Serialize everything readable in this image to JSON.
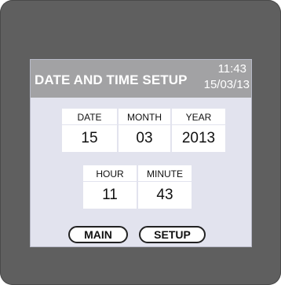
{
  "header": {
    "title": "DATE AND TIME SETUP",
    "time": "11:43",
    "date": "15/03/13"
  },
  "fields": {
    "date_label": "DATE",
    "date_value": "15",
    "month_label": "MONTH",
    "month_value": "03",
    "year_label": "YEAR",
    "year_value": "2013",
    "hour_label": "HOUR",
    "hour_value": "11",
    "minute_label": "MINUTE",
    "minute_value": "43"
  },
  "buttons": {
    "main_label": "MAIN",
    "setup_label": "SETUP"
  },
  "colors": {
    "bezel": "#5f5f5f",
    "header": "#a2a2a4",
    "panel": "#e2e3ee"
  }
}
